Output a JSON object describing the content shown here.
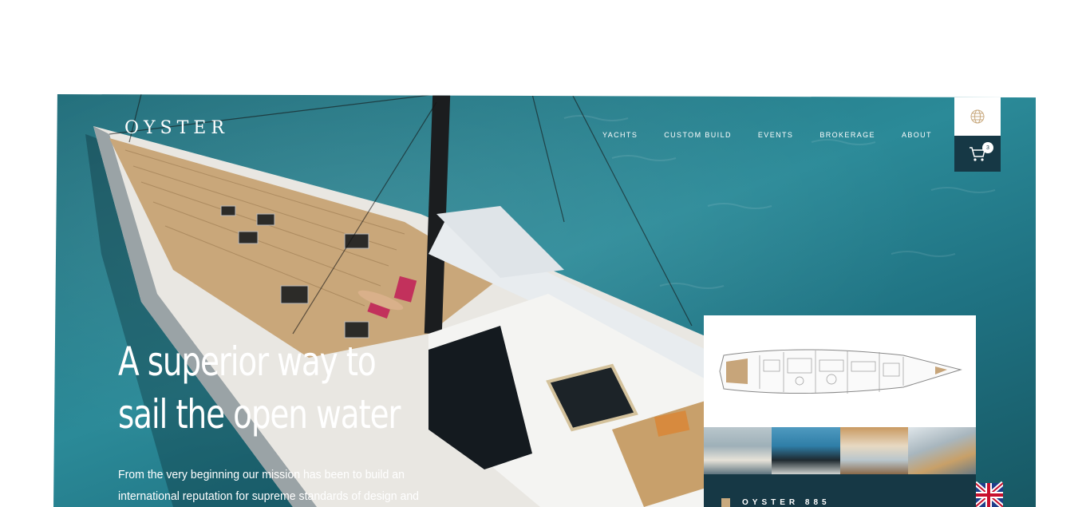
{
  "brand": {
    "logo_text": "OYSTER"
  },
  "nav": {
    "items": [
      {
        "label": "YACHTS"
      },
      {
        "label": "CUSTOM BUILD"
      },
      {
        "label": "EVENTS"
      },
      {
        "label": "BROKERAGE"
      },
      {
        "label": "ABOUT"
      }
    ]
  },
  "utility": {
    "cart_count": "3"
  },
  "hero": {
    "headline_line1": "A superior way to",
    "headline_line2": "sail the open water",
    "intro": "From the very beginning our mission has been to build an international reputation for supreme standards of design and"
  },
  "card": {
    "model_name": "OYSTER 885"
  },
  "colors": {
    "navy": "#163845",
    "sea": "#2b8a98",
    "gold": "#c8a97e",
    "white": "#ffffff"
  }
}
